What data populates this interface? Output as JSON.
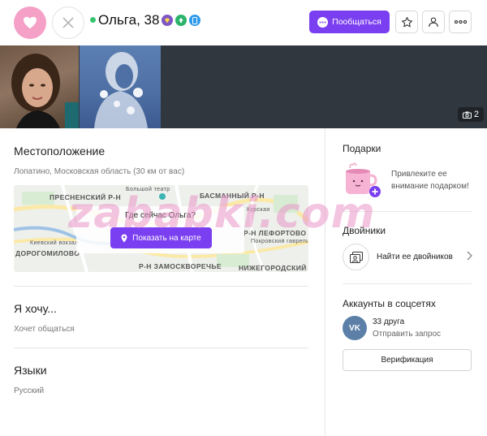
{
  "header": {
    "name_age": "Ольга, 38",
    "chat_label": "Пообщаться",
    "badges": [
      "gem-icon",
      "boost-icon",
      "phone-verified-icon"
    ],
    "colors": {
      "accent": "#7a3ff0",
      "like": "#f5a0c7",
      "online": "#36c46f"
    }
  },
  "photos": {
    "count": "2"
  },
  "location": {
    "title": "Местоположение",
    "text": "Лопатино, Московская область (30 км от вас)",
    "map": {
      "question": "Где сейчас Ольга?",
      "button_label": "Показать на карте",
      "labels": {
        "bolshoi": "Большой театр",
        "presnensky": "ПРЕСНЕНСКИЙ Р-Н",
        "basmanny": "БАСМАННЫЙ Р-Н",
        "kurskaya": "Курская",
        "kievsky": "Киевский вокзал",
        "dorogomilovo": "ДОРОГОМИЛОВО",
        "lefortovo": "Р-Н ЛЕФОРТОВО",
        "pokrovsky": "Покровский гаврепильный...",
        "zamoskvorechye": "Р-Н ЗАМОСКВОРЕЧЬЕ",
        "nizhegorodsky": "НИЖЕГОРОДСКИЙ"
      }
    }
  },
  "wants": {
    "title": "Я хочу...",
    "text": "Хочет общаться"
  },
  "languages": {
    "title": "Языки",
    "text": "Русский"
  },
  "gifts": {
    "title": "Подарки",
    "text": "Привлеките ее внимание подарком!"
  },
  "twins": {
    "title": "Двойники",
    "link": "Найти ее двойников"
  },
  "social": {
    "title": "Аккаунты в соцсетях",
    "vk_label": "VK",
    "friends": "33 друга",
    "request": "Отправить запрос",
    "verify": "Верификация"
  },
  "watermark": "zababki.com"
}
